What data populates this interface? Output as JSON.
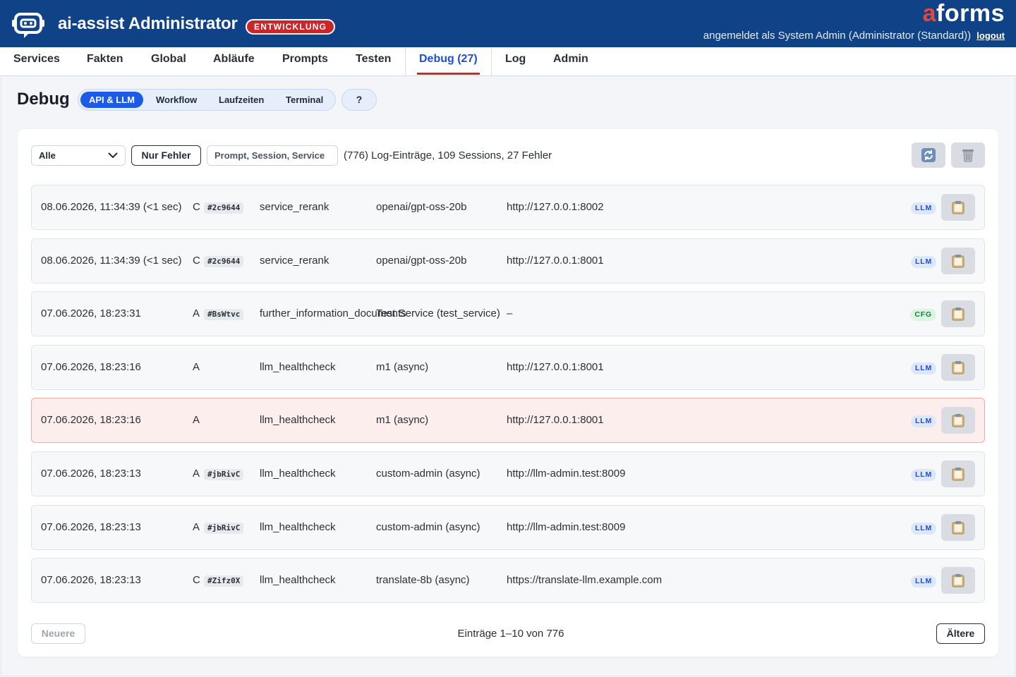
{
  "header": {
    "app_title": "ai-assist Administrator",
    "env_badge": "ENTWICKLUNG",
    "brand_prefix": "a",
    "brand_rest": "forms",
    "user_text": "angemeldet als System Admin (Administrator (Standard))",
    "logout_label": "logout",
    "colors": {
      "bar": "#0f4287",
      "badge": "#c8262a",
      "brand_accent": "#e8453c"
    }
  },
  "nav": {
    "tabs": [
      {
        "label": "Services"
      },
      {
        "label": "Fakten"
      },
      {
        "label": "Global"
      },
      {
        "label": "Abläufe"
      },
      {
        "label": "Prompts"
      },
      {
        "label": "Testen"
      },
      {
        "label": "Debug (27)",
        "active": true
      },
      {
        "label": "Log"
      },
      {
        "label": "Admin"
      }
    ]
  },
  "page": {
    "title": "Debug",
    "subtabs": [
      {
        "label": "API & LLM",
        "active": true
      },
      {
        "label": "Workflow"
      },
      {
        "label": "Laufzeiten"
      },
      {
        "label": "Terminal"
      }
    ],
    "help_label": "?"
  },
  "toolbar": {
    "filter_value": "Alle",
    "errors_only_label": "Nur Fehler",
    "search_placeholder": "Prompt, Session, Service",
    "summary": "(776) Log-Einträge, 109 Sessions, 27 Fehler",
    "refresh_icon": "refresh-icon",
    "trash_icon": "trash-icon"
  },
  "rows": [
    {
      "date": "08.06.2026, 11:34:39 (<1 sec)",
      "letter": "C",
      "tag": "#2c9644",
      "service": "service_rerank",
      "model": "openai/gpt-oss-20b",
      "url": "http://127.0.0.1:8002",
      "kind": "LLM",
      "error": false
    },
    {
      "date": "08.06.2026, 11:34:39 (<1 sec)",
      "letter": "C",
      "tag": "#2c9644",
      "service": "service_rerank",
      "model": "openai/gpt-oss-20b",
      "url": "http://127.0.0.1:8001",
      "kind": "LLM",
      "error": false
    },
    {
      "date": "07.06.2026, 18:23:31",
      "letter": "A",
      "tag": "#BsWtvc",
      "service": "further_information_documents",
      "model": "Test Service (test_service)",
      "url": "–",
      "kind": "CFG",
      "error": false
    },
    {
      "date": "07.06.2026, 18:23:16",
      "letter": "A",
      "tag": "",
      "service": "llm_healthcheck",
      "model": "m1 (async)",
      "url": "http://127.0.0.1:8001",
      "kind": "LLM",
      "error": false
    },
    {
      "date": "07.06.2026, 18:23:16",
      "letter": "A",
      "tag": "",
      "service": "llm_healthcheck",
      "model": "m1 (async)",
      "url": "http://127.0.0.1:8001",
      "kind": "LLM",
      "error": true
    },
    {
      "date": "07.06.2026, 18:23:13",
      "letter": "A",
      "tag": "#jbRivC",
      "service": "llm_healthcheck",
      "model": "custom-admin (async)",
      "url": "http://llm-admin.test:8009",
      "kind": "LLM",
      "error": false
    },
    {
      "date": "07.06.2026, 18:23:13",
      "letter": "A",
      "tag": "#jbRivC",
      "service": "llm_healthcheck",
      "model": "custom-admin (async)",
      "url": "http://llm-admin.test:8009",
      "kind": "LLM",
      "error": false
    },
    {
      "date": "07.06.2026, 18:23:13",
      "letter": "C",
      "tag": "#Zifz0X",
      "service": "llm_healthcheck",
      "model": "translate-8b (async)",
      "url": "https://translate-llm.example.com",
      "kind": "LLM",
      "error": false
    }
  ],
  "pagination": {
    "newer_label": "Neuere",
    "info": "Einträge 1–10 von 776",
    "older_label": "Ältere"
  }
}
